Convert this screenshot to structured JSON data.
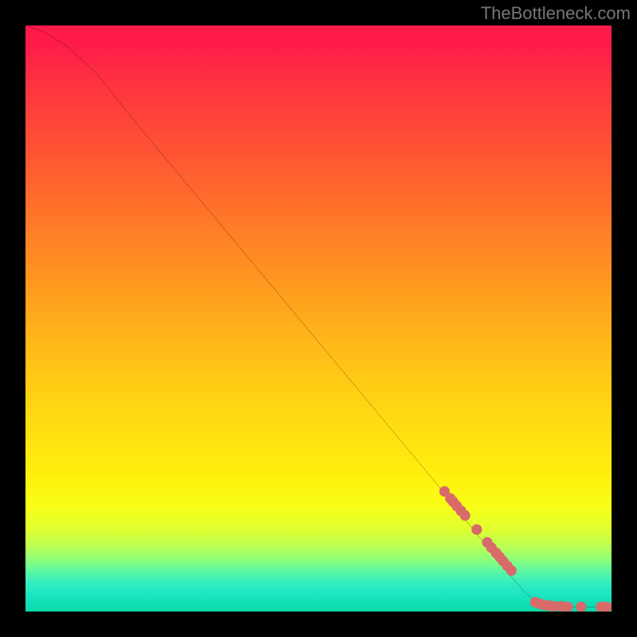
{
  "watermark": "TheBottleneck.com",
  "chart_data": {
    "type": "line",
    "title": "",
    "xlabel": "",
    "ylabel": "",
    "xlim": [
      0,
      100
    ],
    "ylim": [
      0,
      100
    ],
    "curve": [
      {
        "x": 0,
        "y": 100
      },
      {
        "x": 3,
        "y": 99
      },
      {
        "x": 7,
        "y": 96.5
      },
      {
        "x": 12,
        "y": 92
      },
      {
        "x": 20,
        "y": 82
      },
      {
        "x": 30,
        "y": 70
      },
      {
        "x": 40,
        "y": 58
      },
      {
        "x": 50,
        "y": 46
      },
      {
        "x": 60,
        "y": 34
      },
      {
        "x": 70,
        "y": 22
      },
      {
        "x": 78,
        "y": 12
      },
      {
        "x": 82,
        "y": 7
      },
      {
        "x": 85,
        "y": 3.5
      },
      {
        "x": 87,
        "y": 1.8
      },
      {
        "x": 89,
        "y": 1.0
      },
      {
        "x": 92,
        "y": 0.8
      },
      {
        "x": 96,
        "y": 0.8
      },
      {
        "x": 100,
        "y": 0.8
      }
    ],
    "markers": [
      {
        "x": 71.5,
        "y": 20.5
      },
      {
        "x": 72.5,
        "y": 19.3
      },
      {
        "x": 73.0,
        "y": 18.7
      },
      {
        "x": 73.6,
        "y": 18.0
      },
      {
        "x": 74.3,
        "y": 17.2
      },
      {
        "x": 75.0,
        "y": 16.4
      },
      {
        "x": 77.0,
        "y": 14.0
      },
      {
        "x": 78.8,
        "y": 11.8
      },
      {
        "x": 79.5,
        "y": 10.9
      },
      {
        "x": 80.3,
        "y": 10.0
      },
      {
        "x": 80.9,
        "y": 9.3
      },
      {
        "x": 81.5,
        "y": 8.6
      },
      {
        "x": 82.2,
        "y": 7.8
      },
      {
        "x": 82.9,
        "y": 7.0
      },
      {
        "x": 87.0,
        "y": 1.6
      },
      {
        "x": 87.8,
        "y": 1.3
      },
      {
        "x": 88.6,
        "y": 1.1
      },
      {
        "x": 89.4,
        "y": 1.0
      },
      {
        "x": 90.2,
        "y": 0.9
      },
      {
        "x": 91.4,
        "y": 0.9
      },
      {
        "x": 92.5,
        "y": 0.8
      },
      {
        "x": 94.8,
        "y": 0.8
      },
      {
        "x": 98.2,
        "y": 0.8
      },
      {
        "x": 99.2,
        "y": 0.8
      }
    ],
    "marker_color": "#d86a6a",
    "line_color": "#000000",
    "line_width": 2
  }
}
